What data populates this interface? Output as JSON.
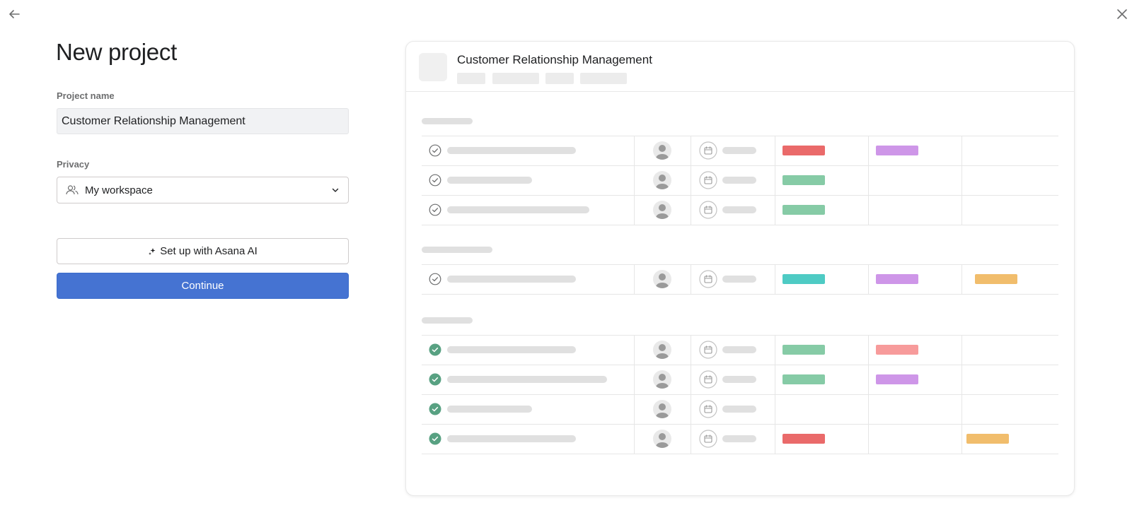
{
  "dialog": {
    "title": "New project"
  },
  "form": {
    "project_name_label": "Project name",
    "project_name_value": "Customer Relationship Management",
    "privacy_label": "Privacy",
    "privacy_value": "My workspace",
    "ai_button_label": "Set up with Asana AI",
    "continue_button_label": "Continue"
  },
  "preview": {
    "project_title": "Customer Relationship Management",
    "sections": [
      {
        "rows": [
          {
            "completed": false,
            "tags": [
              "#ea6a6a",
              "#ce96e8",
              null
            ]
          },
          {
            "completed": false,
            "tags": [
              "#86cba6",
              null,
              null
            ]
          },
          {
            "completed": false,
            "tags": [
              "#86cba6",
              null,
              null
            ]
          }
        ]
      },
      {
        "rows": [
          {
            "completed": false,
            "tags": [
              "#4ecbc4",
              "#ce96e8",
              "#f1bd6c"
            ]
          }
        ]
      },
      {
        "rows": [
          {
            "completed": true,
            "tags": [
              "#86cba6",
              "#f79b9b",
              null
            ]
          },
          {
            "completed": true,
            "tags": [
              "#86cba6",
              "#ce96e8",
              null
            ]
          },
          {
            "completed": true,
            "tags": [
              null,
              null,
              null
            ]
          },
          {
            "completed": true,
            "tags": [
              "#ea6a6a",
              null,
              "#f1bd6c"
            ]
          }
        ]
      }
    ]
  },
  "icons": {
    "back": "arrow-left-icon",
    "close": "close-icon",
    "privacy": "members-icon",
    "dropdown": "chevron-down-icon",
    "ai": "sparkle-icon",
    "row_check": "check-circle-icon",
    "row_avatar": "avatar-icon",
    "row_date": "calendar-icon"
  },
  "colors": {
    "primary": "#4573d2",
    "completed_check": "#58a182"
  }
}
